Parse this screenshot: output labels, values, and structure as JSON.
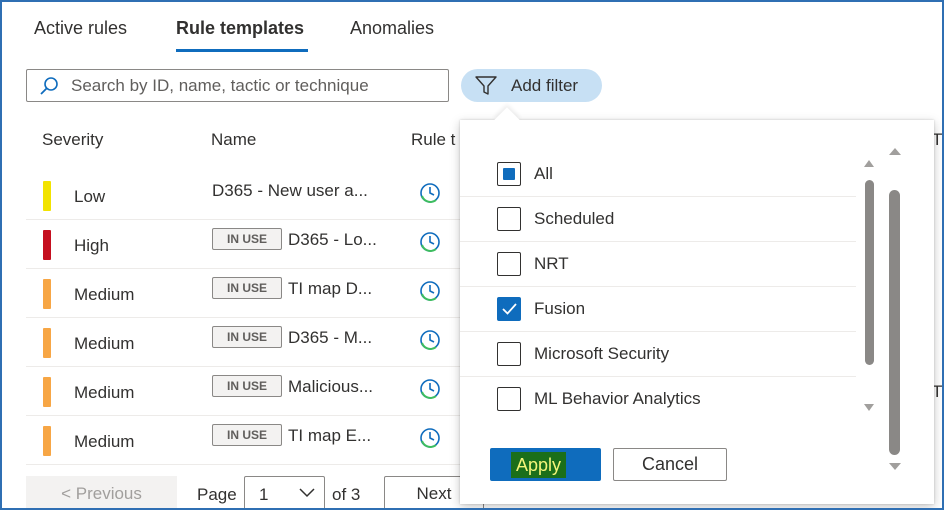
{
  "tabs": [
    {
      "label": "Active rules"
    },
    {
      "label": "Rule templates"
    },
    {
      "label": "Anomalies"
    }
  ],
  "search": {
    "placeholder": "Search by ID, name, tactic or technique",
    "icon": "search-icon"
  },
  "add_filter": {
    "label": "Add filter",
    "icon": "filter-icon"
  },
  "table": {
    "columns": [
      "Severity",
      "Name",
      "Rule t",
      "T"
    ],
    "rows": [
      {
        "severity": "Low",
        "color": "#f2e300",
        "badge": "",
        "name": "D365 - New user a..."
      },
      {
        "severity": "High",
        "color": "#c50f1f",
        "badge": "IN USE",
        "name": "D365 - Lo..."
      },
      {
        "severity": "Medium",
        "color": "#f7a645",
        "badge": "IN USE",
        "name": "TI map D..."
      },
      {
        "severity": "Medium",
        "color": "#f7a645",
        "badge": "IN USE",
        "name": "D365 - M..."
      },
      {
        "severity": "Medium",
        "color": "#f7a645",
        "badge": "IN USE",
        "name": "Malicious..."
      },
      {
        "severity": "Medium",
        "color": "#f7a645",
        "badge": "IN USE",
        "name": "TI map E..."
      }
    ],
    "extra_t": "T"
  },
  "pagination": {
    "previous": "< Previous",
    "page_label": "Page",
    "page_value": "1",
    "of_label": "of 3",
    "next": "Next"
  },
  "filter_dropdown": {
    "options": [
      {
        "label": "All",
        "state": "indeterminate"
      },
      {
        "label": "Scheduled",
        "state": "unchecked"
      },
      {
        "label": "NRT",
        "state": "unchecked"
      },
      {
        "label": "Fusion",
        "state": "checked"
      },
      {
        "label": "Microsoft Security",
        "state": "unchecked"
      },
      {
        "label": "ML Behavior Analytics",
        "state": "unchecked"
      }
    ],
    "apply": "Apply",
    "cancel": "Cancel"
  },
  "colors": {
    "accent": "#0f6cbd",
    "apply_highlight_bg": "#1b6f1a",
    "apply_highlight_text": "#f5f57a",
    "filter_pill": "#c7e0f4",
    "frame": "#2f6fb3"
  }
}
